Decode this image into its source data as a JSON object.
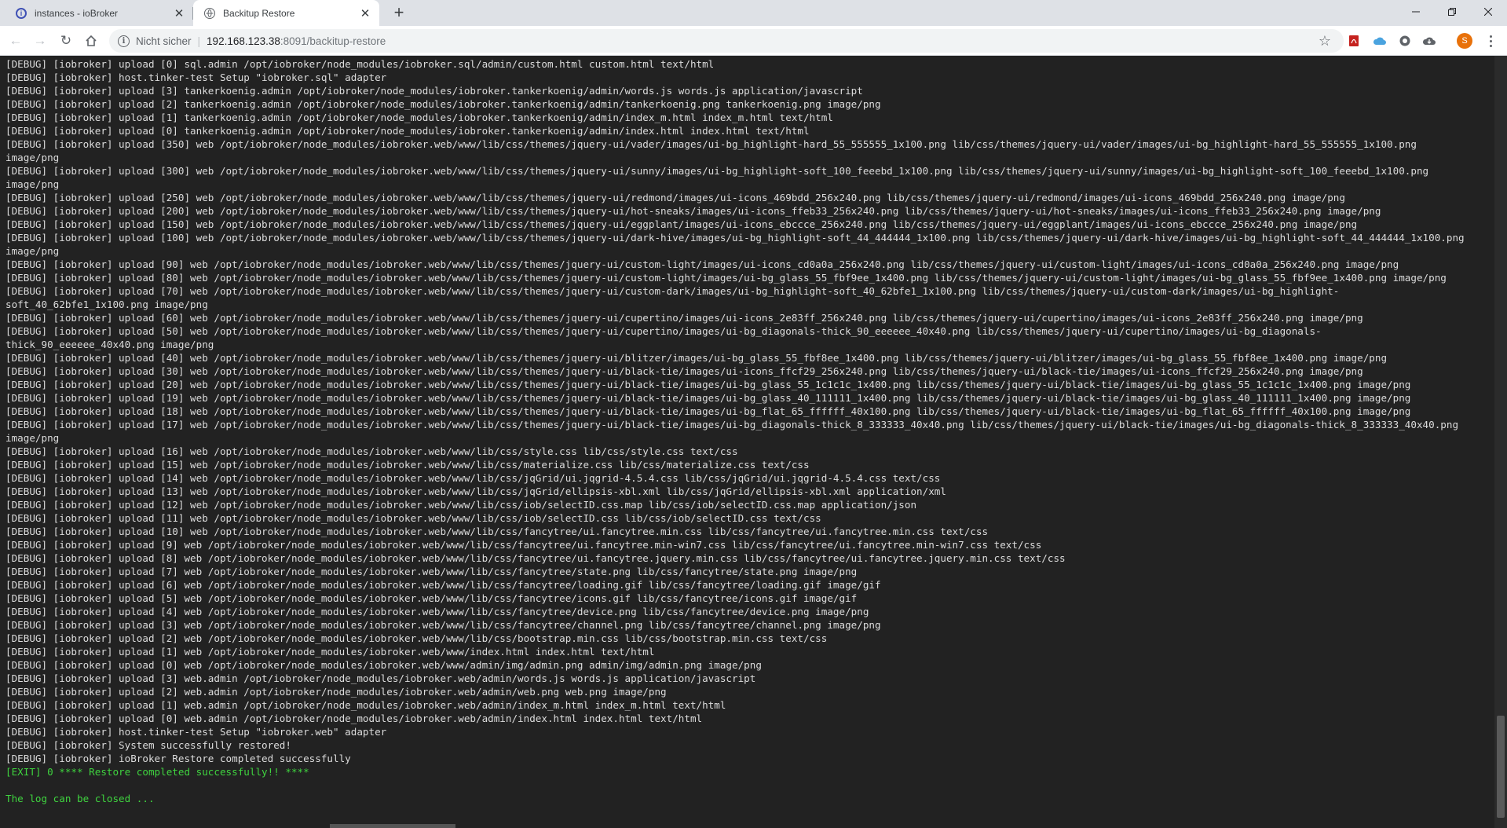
{
  "browser": {
    "tabs": [
      {
        "title": "instances - ioBroker",
        "favicon": "iobroker-logo-icon"
      },
      {
        "title": "Backitup Restore",
        "favicon": "globe-icon"
      }
    ],
    "new_tab_label": "+",
    "security_label": "Nicht sicher",
    "url_host": "192.168.123.38",
    "url_rest": ":8091/backitup-restore",
    "avatar_letter": "S",
    "extension_icons": [
      "pdf-icon",
      "cloud-icon",
      "record-icon",
      "cloud-download-icon"
    ],
    "colors": {
      "tab_strip": "#dee1e6",
      "toolbar": "#ffffff",
      "avatar": "#e8710a"
    }
  },
  "log": {
    "background": "#222222",
    "text_color": "#dcdcdc",
    "success_color": "#3fd43f",
    "lines": [
      {
        "text": "[DEBUG] [iobroker] upload [0] sql.admin /opt/iobroker/node_modules/iobroker.sql/admin/custom.html custom.html text/html"
      },
      {
        "text": "[DEBUG] [iobroker] host.tinker-test Setup \"iobroker.sql\" adapter"
      },
      {
        "text": "[DEBUG] [iobroker] upload [3] tankerkoenig.admin /opt/iobroker/node_modules/iobroker.tankerkoenig/admin/words.js words.js application/javascript"
      },
      {
        "text": "[DEBUG] [iobroker] upload [2] tankerkoenig.admin /opt/iobroker/node_modules/iobroker.tankerkoenig/admin/tankerkoenig.png tankerkoenig.png image/png"
      },
      {
        "text": "[DEBUG] [iobroker] upload [1] tankerkoenig.admin /opt/iobroker/node_modules/iobroker.tankerkoenig/admin/index_m.html index_m.html text/html"
      },
      {
        "text": "[DEBUG] [iobroker] upload [0] tankerkoenig.admin /opt/iobroker/node_modules/iobroker.tankerkoenig/admin/index.html index.html text/html"
      },
      {
        "text": "[DEBUG] [iobroker] upload [350] web /opt/iobroker/node_modules/iobroker.web/www/lib/css/themes/jquery-ui/vader/images/ui-bg_highlight-hard_55_555555_1x100.png lib/css/themes/jquery-ui/vader/images/ui-bg_highlight-hard_55_555555_1x100.png\nimage/png"
      },
      {
        "text": "[DEBUG] [iobroker] upload [300] web /opt/iobroker/node_modules/iobroker.web/www/lib/css/themes/jquery-ui/sunny/images/ui-bg_highlight-soft_100_feeebd_1x100.png lib/css/themes/jquery-ui/sunny/images/ui-bg_highlight-soft_100_feeebd_1x100.png\nimage/png"
      },
      {
        "text": "[DEBUG] [iobroker] upload [250] web /opt/iobroker/node_modules/iobroker.web/www/lib/css/themes/jquery-ui/redmond/images/ui-icons_469bdd_256x240.png lib/css/themes/jquery-ui/redmond/images/ui-icons_469bdd_256x240.png image/png"
      },
      {
        "text": "[DEBUG] [iobroker] upload [200] web /opt/iobroker/node_modules/iobroker.web/www/lib/css/themes/jquery-ui/hot-sneaks/images/ui-icons_ffeb33_256x240.png lib/css/themes/jquery-ui/hot-sneaks/images/ui-icons_ffeb33_256x240.png image/png"
      },
      {
        "text": "[DEBUG] [iobroker] upload [150] web /opt/iobroker/node_modules/iobroker.web/www/lib/css/themes/jquery-ui/eggplant/images/ui-icons_ebccce_256x240.png lib/css/themes/jquery-ui/eggplant/images/ui-icons_ebccce_256x240.png image/png"
      },
      {
        "text": "[DEBUG] [iobroker] upload [100] web /opt/iobroker/node_modules/iobroker.web/www/lib/css/themes/jquery-ui/dark-hive/images/ui-bg_highlight-soft_44_444444_1x100.png lib/css/themes/jquery-ui/dark-hive/images/ui-bg_highlight-soft_44_444444_1x100.png\nimage/png"
      },
      {
        "text": "[DEBUG] [iobroker] upload [90] web /opt/iobroker/node_modules/iobroker.web/www/lib/css/themes/jquery-ui/custom-light/images/ui-icons_cd0a0a_256x240.png lib/css/themes/jquery-ui/custom-light/images/ui-icons_cd0a0a_256x240.png image/png"
      },
      {
        "text": "[DEBUG] [iobroker] upload [80] web /opt/iobroker/node_modules/iobroker.web/www/lib/css/themes/jquery-ui/custom-light/images/ui-bg_glass_55_fbf9ee_1x400.png lib/css/themes/jquery-ui/custom-light/images/ui-bg_glass_55_fbf9ee_1x400.png image/png"
      },
      {
        "text": "[DEBUG] [iobroker] upload [70] web /opt/iobroker/node_modules/iobroker.web/www/lib/css/themes/jquery-ui/custom-dark/images/ui-bg_highlight-soft_40_62bfe1_1x100.png lib/css/themes/jquery-ui/custom-dark/images/ui-bg_highlight-\nsoft_40_62bfe1_1x100.png image/png"
      },
      {
        "text": "[DEBUG] [iobroker] upload [60] web /opt/iobroker/node_modules/iobroker.web/www/lib/css/themes/jquery-ui/cupertino/images/ui-icons_2e83ff_256x240.png lib/css/themes/jquery-ui/cupertino/images/ui-icons_2e83ff_256x240.png image/png"
      },
      {
        "text": "[DEBUG] [iobroker] upload [50] web /opt/iobroker/node_modules/iobroker.web/www/lib/css/themes/jquery-ui/cupertino/images/ui-bg_diagonals-thick_90_eeeeee_40x40.png lib/css/themes/jquery-ui/cupertino/images/ui-bg_diagonals-\nthick_90_eeeeee_40x40.png image/png"
      },
      {
        "text": "[DEBUG] [iobroker] upload [40] web /opt/iobroker/node_modules/iobroker.web/www/lib/css/themes/jquery-ui/blitzer/images/ui-bg_glass_55_fbf8ee_1x400.png lib/css/themes/jquery-ui/blitzer/images/ui-bg_glass_55_fbf8ee_1x400.png image/png"
      },
      {
        "text": "[DEBUG] [iobroker] upload [30] web /opt/iobroker/node_modules/iobroker.web/www/lib/css/themes/jquery-ui/black-tie/images/ui-icons_ffcf29_256x240.png lib/css/themes/jquery-ui/black-tie/images/ui-icons_ffcf29_256x240.png image/png"
      },
      {
        "text": "[DEBUG] [iobroker] upload [20] web /opt/iobroker/node_modules/iobroker.web/www/lib/css/themes/jquery-ui/black-tie/images/ui-bg_glass_55_1c1c1c_1x400.png lib/css/themes/jquery-ui/black-tie/images/ui-bg_glass_55_1c1c1c_1x400.png image/png"
      },
      {
        "text": "[DEBUG] [iobroker] upload [19] web /opt/iobroker/node_modules/iobroker.web/www/lib/css/themes/jquery-ui/black-tie/images/ui-bg_glass_40_111111_1x400.png lib/css/themes/jquery-ui/black-tie/images/ui-bg_glass_40_111111_1x400.png image/png"
      },
      {
        "text": "[DEBUG] [iobroker] upload [18] web /opt/iobroker/node_modules/iobroker.web/www/lib/css/themes/jquery-ui/black-tie/images/ui-bg_flat_65_ffffff_40x100.png lib/css/themes/jquery-ui/black-tie/images/ui-bg_flat_65_ffffff_40x100.png image/png"
      },
      {
        "text": "[DEBUG] [iobroker] upload [17] web /opt/iobroker/node_modules/iobroker.web/www/lib/css/themes/jquery-ui/black-tie/images/ui-bg_diagonals-thick_8_333333_40x40.png lib/css/themes/jquery-ui/black-tie/images/ui-bg_diagonals-thick_8_333333_40x40.png\nimage/png"
      },
      {
        "text": "[DEBUG] [iobroker] upload [16] web /opt/iobroker/node_modules/iobroker.web/www/lib/css/style.css lib/css/style.css text/css"
      },
      {
        "text": "[DEBUG] [iobroker] upload [15] web /opt/iobroker/node_modules/iobroker.web/www/lib/css/materialize.css lib/css/materialize.css text/css"
      },
      {
        "text": "[DEBUG] [iobroker] upload [14] web /opt/iobroker/node_modules/iobroker.web/www/lib/css/jqGrid/ui.jqgrid-4.5.4.css lib/css/jqGrid/ui.jqgrid-4.5.4.css text/css"
      },
      {
        "text": "[DEBUG] [iobroker] upload [13] web /opt/iobroker/node_modules/iobroker.web/www/lib/css/jqGrid/ellipsis-xbl.xml lib/css/jqGrid/ellipsis-xbl.xml application/xml"
      },
      {
        "text": "[DEBUG] [iobroker] upload [12] web /opt/iobroker/node_modules/iobroker.web/www/lib/css/iob/selectID.css.map lib/css/iob/selectID.css.map application/json"
      },
      {
        "text": "[DEBUG] [iobroker] upload [11] web /opt/iobroker/node_modules/iobroker.web/www/lib/css/iob/selectID.css lib/css/iob/selectID.css text/css"
      },
      {
        "text": "[DEBUG] [iobroker] upload [10] web /opt/iobroker/node_modules/iobroker.web/www/lib/css/fancytree/ui.fancytree.min.css lib/css/fancytree/ui.fancytree.min.css text/css"
      },
      {
        "text": "[DEBUG] [iobroker] upload [9] web /opt/iobroker/node_modules/iobroker.web/www/lib/css/fancytree/ui.fancytree.min-win7.css lib/css/fancytree/ui.fancytree.min-win7.css text/css"
      },
      {
        "text": "[DEBUG] [iobroker] upload [8] web /opt/iobroker/node_modules/iobroker.web/www/lib/css/fancytree/ui.fancytree.jquery.min.css lib/css/fancytree/ui.fancytree.jquery.min.css text/css"
      },
      {
        "text": "[DEBUG] [iobroker] upload [7] web /opt/iobroker/node_modules/iobroker.web/www/lib/css/fancytree/state.png lib/css/fancytree/state.png image/png"
      },
      {
        "text": "[DEBUG] [iobroker] upload [6] web /opt/iobroker/node_modules/iobroker.web/www/lib/css/fancytree/loading.gif lib/css/fancytree/loading.gif image/gif"
      },
      {
        "text": "[DEBUG] [iobroker] upload [5] web /opt/iobroker/node_modules/iobroker.web/www/lib/css/fancytree/icons.gif lib/css/fancytree/icons.gif image/gif"
      },
      {
        "text": "[DEBUG] [iobroker] upload [4] web /opt/iobroker/node_modules/iobroker.web/www/lib/css/fancytree/device.png lib/css/fancytree/device.png image/png"
      },
      {
        "text": "[DEBUG] [iobroker] upload [3] web /opt/iobroker/node_modules/iobroker.web/www/lib/css/fancytree/channel.png lib/css/fancytree/channel.png image/png"
      },
      {
        "text": "[DEBUG] [iobroker] upload [2] web /opt/iobroker/node_modules/iobroker.web/www/lib/css/bootstrap.min.css lib/css/bootstrap.min.css text/css"
      },
      {
        "text": "[DEBUG] [iobroker] upload [1] web /opt/iobroker/node_modules/iobroker.web/www/index.html index.html text/html"
      },
      {
        "text": "[DEBUG] [iobroker] upload [0] web /opt/iobroker/node_modules/iobroker.web/www/admin/img/admin.png admin/img/admin.png image/png"
      },
      {
        "text": "[DEBUG] [iobroker] upload [3] web.admin /opt/iobroker/node_modules/iobroker.web/admin/words.js words.js application/javascript"
      },
      {
        "text": "[DEBUG] [iobroker] upload [2] web.admin /opt/iobroker/node_modules/iobroker.web/admin/web.png web.png image/png"
      },
      {
        "text": "[DEBUG] [iobroker] upload [1] web.admin /opt/iobroker/node_modules/iobroker.web/admin/index_m.html index_m.html text/html"
      },
      {
        "text": "[DEBUG] [iobroker] upload [0] web.admin /opt/iobroker/node_modules/iobroker.web/admin/index.html index.html text/html"
      },
      {
        "text": "[DEBUG] [iobroker] host.tinker-test Setup \"iobroker.web\" adapter"
      },
      {
        "text": "[DEBUG] [iobroker] System successfully restored!"
      },
      {
        "text": "[DEBUG] [iobroker] ioBroker Restore completed successfully"
      },
      {
        "text": "[EXIT] 0 **** Restore completed successfully!! ****",
        "style": "green"
      },
      {
        "text": "",
        "style": "blank"
      },
      {
        "text": "The log can be closed ...",
        "style": "green"
      }
    ]
  }
}
